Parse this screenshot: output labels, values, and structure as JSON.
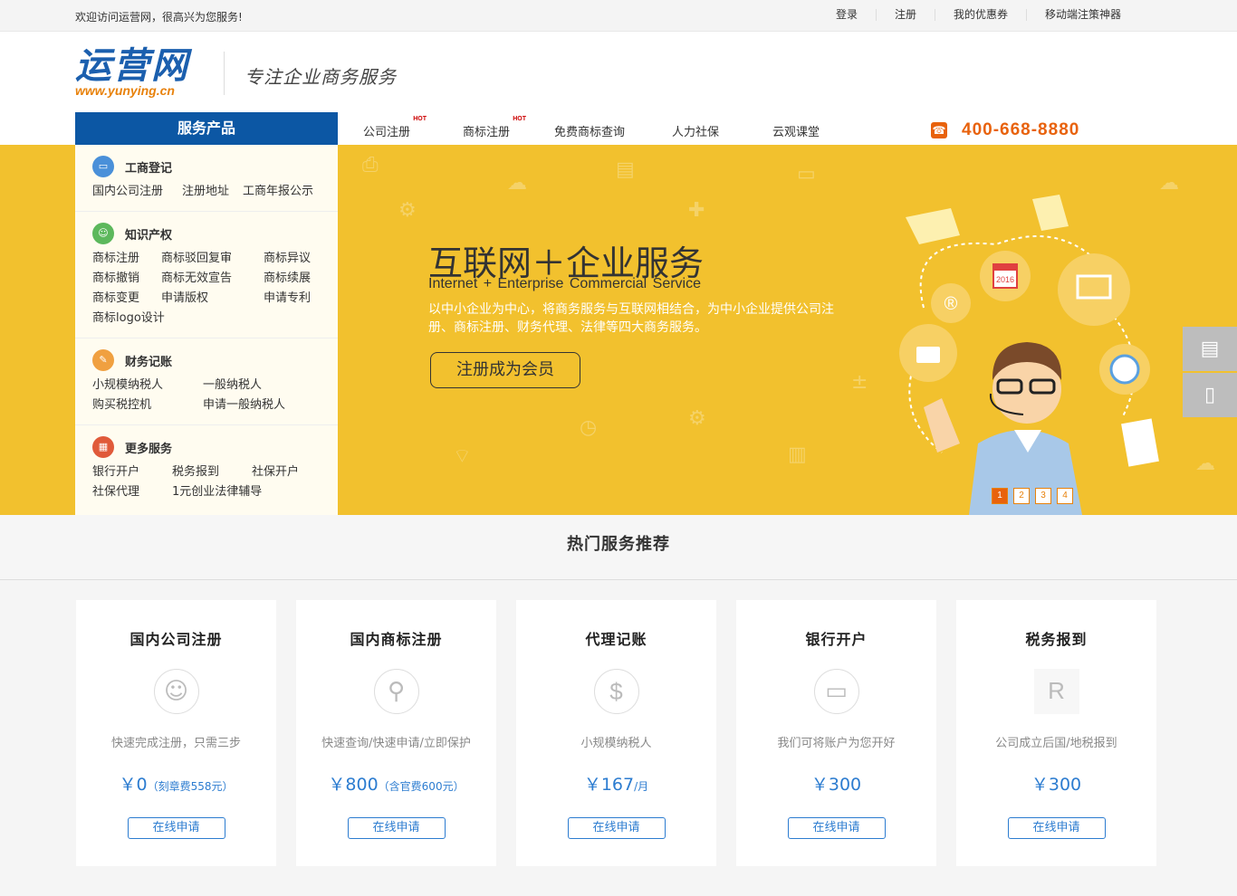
{
  "topbar": {
    "welcome": "欢迎访问运营网，很高兴为您服务!",
    "links": [
      "登录",
      "注册",
      "我的优惠券",
      "移动端注策神器"
    ]
  },
  "header": {
    "logo_cn": "运营网",
    "logo_en": "www.yunying.cn",
    "slogan": "专注企业商务服务"
  },
  "nav": {
    "category": "服务产品",
    "items": [
      {
        "label": "公司注册",
        "hot": "HOT"
      },
      {
        "label": "商标注册",
        "hot": "HOT"
      },
      {
        "label": "免费商标查询"
      },
      {
        "label": "人力社保"
      },
      {
        "label": "云观课堂"
      }
    ],
    "phone": "400-668-8880"
  },
  "sidemenu": [
    {
      "title": "工商登记",
      "icon": "monitor-icon",
      "color": "#4a90d9",
      "cols": 3,
      "links": [
        "国内公司注册",
        "注册地址",
        "工商年报公示"
      ]
    },
    {
      "title": "知识产权",
      "icon": "person-icon",
      "color": "#5cb85c",
      "cols": 3,
      "links": [
        "商标注册",
        "商标驳回复审",
        "商标异议",
        "商标撤销",
        "商标无效宣告",
        "商标续展",
        "商标变更",
        "申请版权",
        "申请专利",
        "商标logo设计"
      ]
    },
    {
      "title": "财务记账",
      "icon": "edit-icon",
      "color": "#f0a040",
      "cols": 2,
      "links": [
        "小规模纳税人",
        "一般纳税人",
        "购买税控机",
        "申请一般纳税人"
      ]
    },
    {
      "title": "更多服务",
      "icon": "grid-icon",
      "color": "#e05a3a",
      "cols": 3,
      "links": [
        "银行开户",
        "税务报到",
        "社保开户",
        "社保代理",
        "1元创业法律辅导"
      ]
    }
  ],
  "banner": {
    "title": "互联网＋企业服务",
    "title_en": "Internet + Enterprise  Commercial  Service",
    "desc": "以中小企业为中心，将商务服务与互联网相结合，为中小企业提供公司注册、商标注册、财务代理、法律等四大商务服务。",
    "button": "注册成为会员",
    "badge_year": "2016",
    "dots": [
      "1",
      "2",
      "3",
      "4"
    ]
  },
  "hot": {
    "title": "热门服务推荐",
    "cards": [
      {
        "title": "国内公司注册",
        "icon": "user-icon",
        "desc": "快速完成注册，只需三步",
        "price": "￥0",
        "price_note": "（刻章费558元）",
        "button": "在线申请"
      },
      {
        "title": "国内商标注册",
        "icon": "search-icon",
        "desc": "快速查询/快速申请/立即保护",
        "price": "￥800",
        "price_note": "（含官费600元）",
        "button": "在线申请"
      },
      {
        "title": "代理记账",
        "icon": "dollar-icon",
        "desc": "小规模纳税人",
        "price": "￥167",
        "price_note": "/月",
        "button": "在线申请"
      },
      {
        "title": "银行开户",
        "icon": "monitor-icon",
        "desc": "我们可将账户为您开好",
        "price": "￥300",
        "price_note": "",
        "button": "在线申请"
      },
      {
        "title": "税务报到",
        "icon": "registered-icon",
        "desc": "公司成立后国/地税报到",
        "price": "￥300",
        "price_note": "",
        "button": "在线申请"
      }
    ]
  },
  "colors": {
    "brand_blue": "#0c57a4",
    "accent_orange": "#e8620c",
    "banner_yellow": "#f2c12e",
    "price_blue": "#2c7cd0"
  }
}
